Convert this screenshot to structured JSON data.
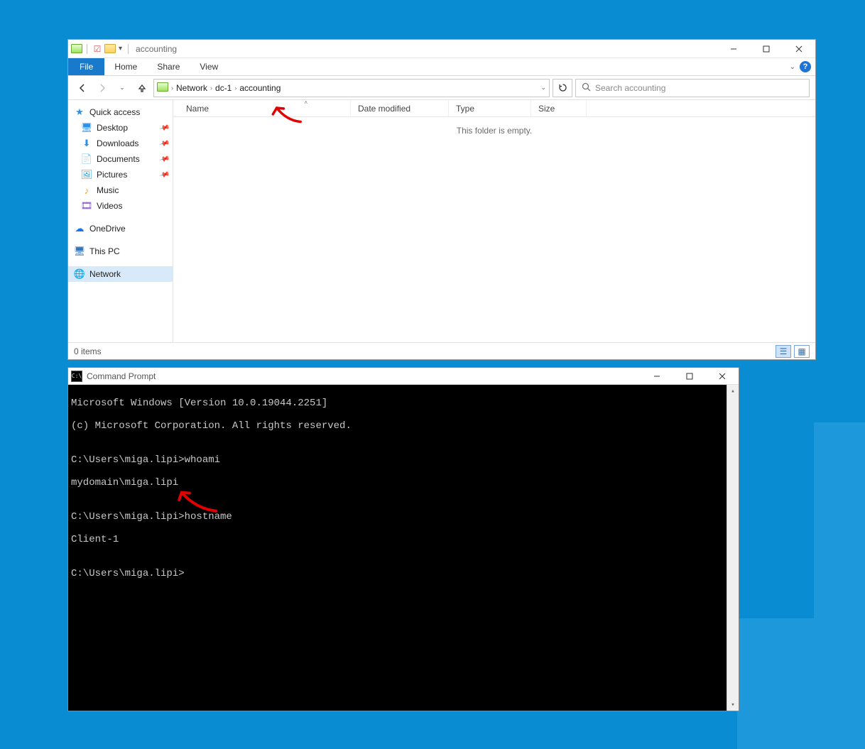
{
  "explorer": {
    "title": "accounting",
    "ribbon": {
      "file": "File",
      "home": "Home",
      "share": "Share",
      "view": "View"
    },
    "breadcrumb": [
      "Network",
      "dc-1",
      "accounting"
    ],
    "search_placeholder": "Search accounting",
    "columns": {
      "name": "Name",
      "date": "Date modified",
      "type": "Type",
      "size": "Size"
    },
    "empty": "This folder is empty.",
    "status": "0 items",
    "sidebar": {
      "quick": "Quick access",
      "desktop": "Desktop",
      "downloads": "Downloads",
      "documents": "Documents",
      "pictures": "Pictures",
      "music": "Music",
      "videos": "Videos",
      "onedrive": "OneDrive",
      "thispc": "This PC",
      "network": "Network"
    }
  },
  "cmd": {
    "title": "Command Prompt",
    "lines": [
      "Microsoft Windows [Version 10.0.19044.2251]",
      "(c) Microsoft Corporation. All rights reserved.",
      "",
      "C:\\Users\\miga.lipi>whoami",
      "mydomain\\miga.lipi",
      "",
      "C:\\Users\\miga.lipi>hostname",
      "Client-1",
      "",
      "C:\\Users\\miga.lipi>"
    ]
  }
}
